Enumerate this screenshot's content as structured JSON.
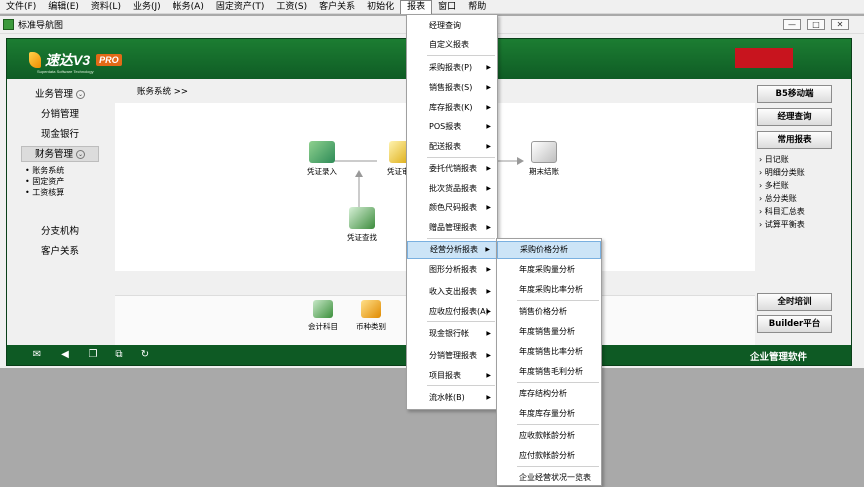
{
  "menubar": [
    "文件(F)",
    "编辑(E)",
    "资料(L)",
    "业务(J)",
    "帐务(A)",
    "固定资产(T)",
    "工资(S)",
    "客户关系",
    "初始化",
    "报表",
    "窗口",
    "帮助"
  ],
  "window": {
    "title": "标准导航图"
  },
  "logo": {
    "brand": "速达V3",
    "edition": "PRO",
    "subtitle": "Superdata Software Technology"
  },
  "nav": {
    "items": [
      "业务管理",
      "分销管理",
      "现金银行",
      "财务管理",
      "分支机构",
      "客户关系"
    ],
    "sub_items": [
      "账务系统",
      "固定资产",
      "工资核算"
    ]
  },
  "breadcrumb": "账务系统 >>",
  "flow": {
    "nodes": [
      "凭证录入",
      "凭证审核",
      "凭证查找",
      "期末结账"
    ]
  },
  "bottom_icons": [
    "会计科目",
    "币种类别"
  ],
  "right_buttons": [
    "B5移动端",
    "经理查询",
    "常用报表"
  ],
  "right_links": [
    "日记账",
    "明细分类账",
    "多栏账",
    "总分类账",
    "科目汇总表",
    "试算平衡表"
  ],
  "right_bottom_buttons": [
    "全时培训",
    "Builder平台"
  ],
  "statusbar": {
    "label": "企业管理软件"
  },
  "report_menu": {
    "items": [
      {
        "label": "经理查询",
        "submenu": false
      },
      {
        "label": "自定义报表",
        "submenu": false
      },
      {
        "label": "采购报表(P)",
        "submenu": true
      },
      {
        "label": "销售报表(S)",
        "submenu": true
      },
      {
        "label": "库存报表(K)",
        "submenu": true
      },
      {
        "label": "POS报表",
        "submenu": true
      },
      {
        "label": "配送报表",
        "submenu": true
      },
      {
        "label": "委托代销报表",
        "submenu": true
      },
      {
        "label": "批次货品报表",
        "submenu": true
      },
      {
        "label": "颜色尺码报表",
        "submenu": true
      },
      {
        "label": "赠品管理报表",
        "submenu": true
      },
      {
        "label": "经营分析报表",
        "submenu": true
      },
      {
        "label": "图形分析报表",
        "submenu": true
      },
      {
        "label": "收入支出报表",
        "submenu": true
      },
      {
        "label": "应收应付报表(A)",
        "submenu": true
      },
      {
        "label": "现金银行帐",
        "submenu": true
      },
      {
        "label": "分销管理报表",
        "submenu": true
      },
      {
        "label": "项目报表",
        "submenu": true
      },
      {
        "label": "流水帐(B)",
        "submenu": true
      }
    ]
  },
  "analysis_submenu": {
    "items": [
      "采购价格分析",
      "年度采购量分析",
      "年度采购比率分析",
      "销售价格分析",
      "年度销售量分析",
      "年度销售比率分析",
      "年度销售毛利分析",
      "库存结构分析",
      "年度库存量分析",
      "应收款帐龄分析",
      "应付款帐龄分析",
      "企业经营状况一览表"
    ]
  },
  "colors": {
    "frame_green": "#0e5a24",
    "menu_highlight": "#cce4f7",
    "logo_red": "#c8141e",
    "pro_orange": "#e36a17"
  },
  "icons": [
    "mail-icon",
    "speaker-icon",
    "book-icon",
    "copy-icon",
    "refresh-icon"
  ]
}
